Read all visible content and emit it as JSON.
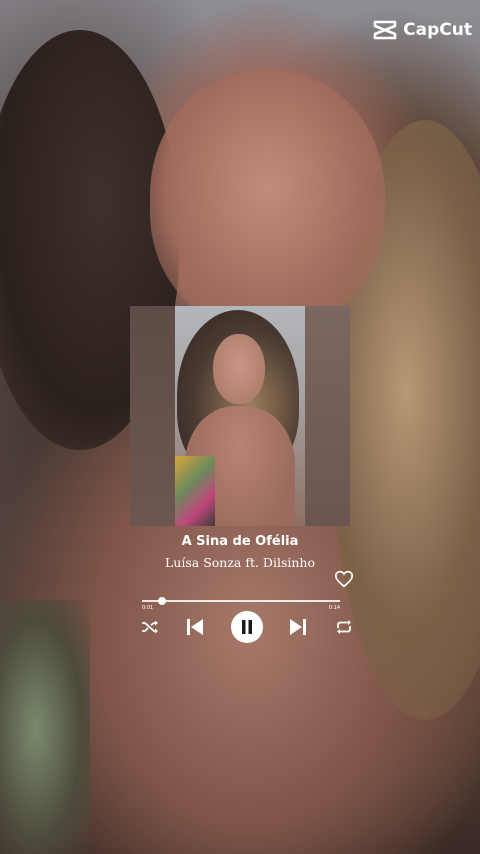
{
  "app": {
    "logo_text": "CapCut"
  },
  "track": {
    "title": "A Sina de Ofélia",
    "artist": "Luísa Sonza ft. Dilsinho",
    "elapsed": "0:01",
    "duration": "0:14",
    "progress": 0.1
  },
  "icons": {
    "logo": "capcut-logo-icon",
    "like": "heart-icon",
    "shuffle": "shuffle-icon",
    "previous": "skip-previous-icon",
    "pause": "pause-icon",
    "next": "skip-next-icon",
    "repeat": "repeat-icon"
  },
  "colors": {
    "text": "#ffffff",
    "control": "#ffffff"
  }
}
